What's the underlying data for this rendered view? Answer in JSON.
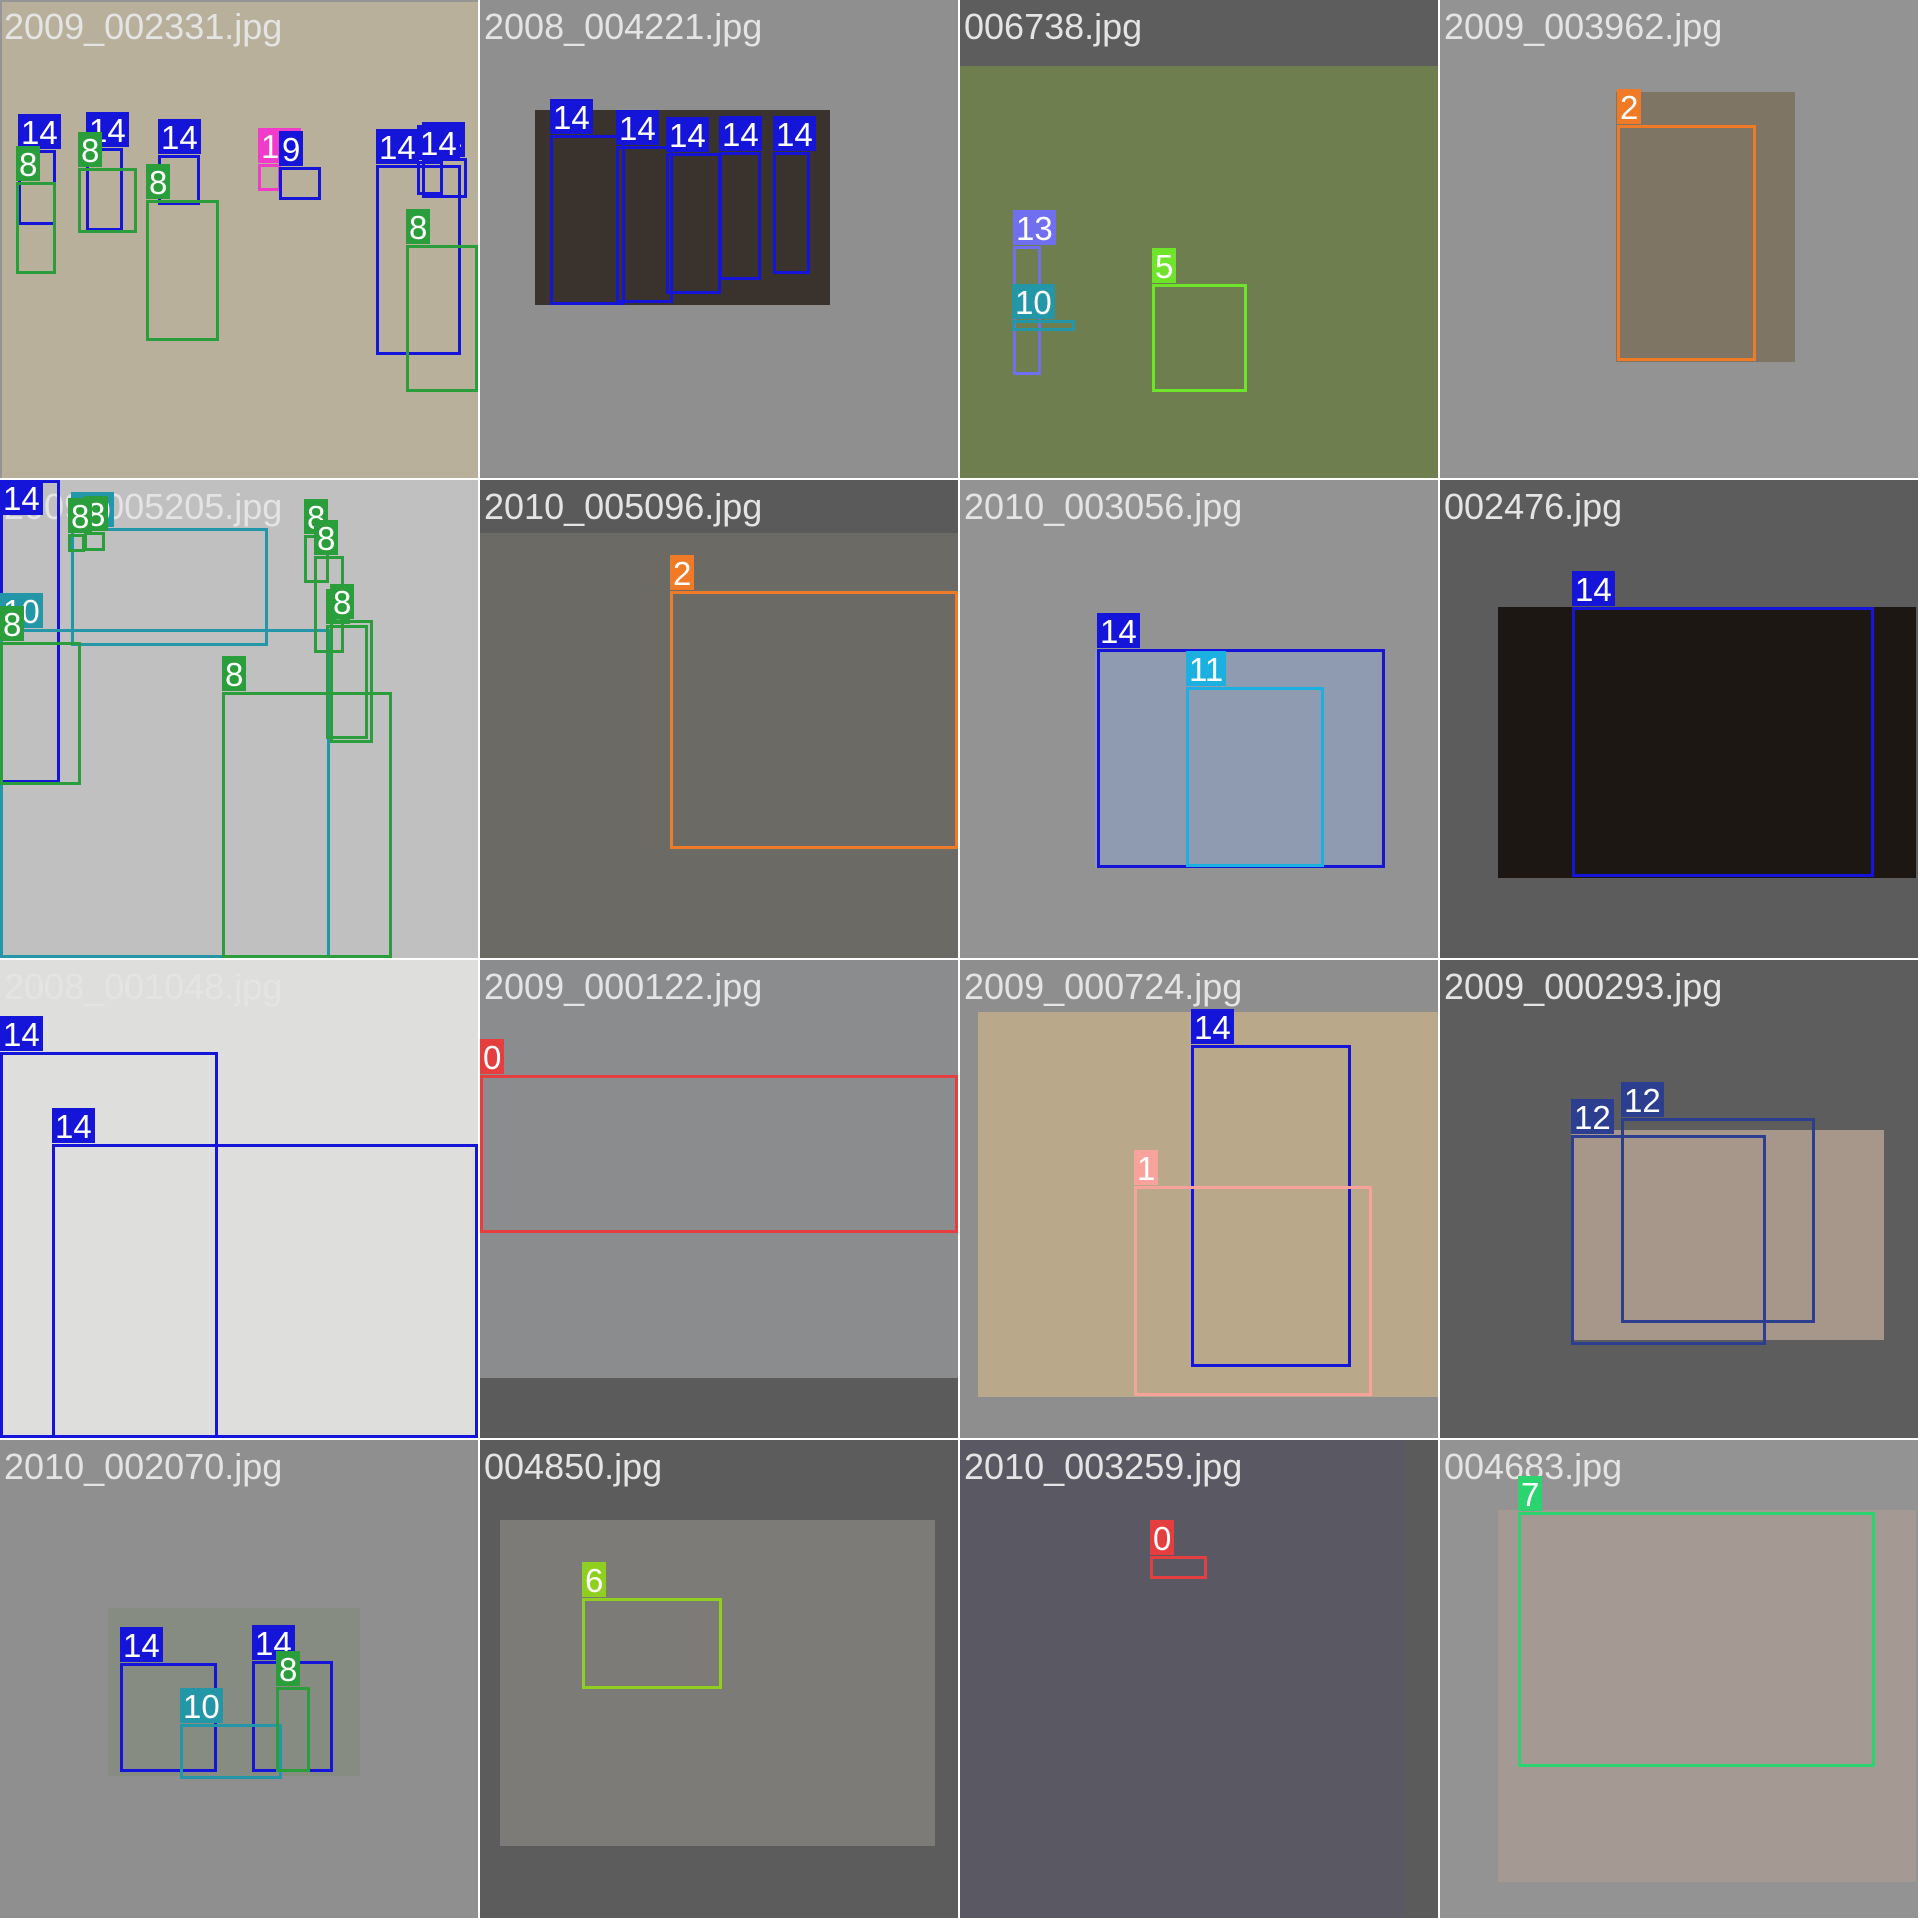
{
  "tiles": [
    {
      "file": "2009_002331.jpg",
      "bg": "#959595",
      "pic": "#b8b09a",
      "labels": [
        "14",
        "14",
        "14",
        "14",
        "14",
        "14",
        "19",
        "9",
        "8",
        "8",
        "8",
        "8"
      ]
    },
    {
      "file": "2008_004221.jpg",
      "bg": "#8f8f8f",
      "pic": "#3a332d",
      "labels": [
        "14",
        "14",
        "14",
        "14",
        "14"
      ]
    },
    {
      "file": "006738.jpg",
      "bg": "#5d5d5d",
      "pic": "#6f7e4e",
      "labels": [
        "13",
        "10",
        "5"
      ]
    },
    {
      "file": "2009_003962.jpg",
      "bg": "#939393",
      "pic": "#7f7565",
      "labels": [
        "2"
      ]
    },
    {
      "file": "2009_005205.jpg",
      "bg": "#8e8e8e",
      "pic": "#c0c0c0",
      "labels": [
        "14",
        "10",
        "10",
        "8",
        "8",
        "8",
        "8",
        "8",
        "8",
        "8",
        "8"
      ]
    },
    {
      "file": "2010_005096.jpg",
      "bg": "#5a5a5a",
      "pic": "#6b6a64",
      "labels": [
        "2"
      ]
    },
    {
      "file": "2010_003056.jpg",
      "bg": "#939393",
      "pic": "#8f9bb0",
      "labels": [
        "14",
        "11"
      ]
    },
    {
      "file": "002476.jpg",
      "bg": "#5c5c5c",
      "pic": "#1d1714",
      "labels": [
        "14"
      ]
    },
    {
      "file": "2008_001048.jpg",
      "bg": "#959595",
      "pic": "#dedfdc",
      "labels": [
        "14",
        "14"
      ]
    },
    {
      "file": "2009_000122.jpg",
      "bg": "#5b5b5b",
      "pic": "#8a8c8d",
      "labels": [
        "0"
      ]
    },
    {
      "file": "2009_000724.jpg",
      "bg": "#8e8e8e",
      "pic": "#b9a98a",
      "labels": [
        "14",
        "1"
      ]
    },
    {
      "file": "2009_000293.jpg",
      "bg": "#5d5d5d",
      "pic": "#a6978a",
      "labels": [
        "12",
        "12"
      ]
    },
    {
      "file": "2010_002070.jpg",
      "bg": "#8f8f8f",
      "pic": "#868c81",
      "labels": [
        "14",
        "14",
        "10",
        "8"
      ]
    },
    {
      "file": "004850.jpg",
      "bg": "#5c5c5c",
      "pic": "#7d7b78",
      "labels": [
        "6"
      ]
    },
    {
      "file": "2010_003259.jpg",
      "bg": "#5b5b5b",
      "pic": "#5a5863",
      "labels": [
        "0"
      ]
    },
    {
      "file": "004683.jpg",
      "bg": "#939393",
      "pic": "#a49a93",
      "labels": [
        "7"
      ]
    }
  ],
  "class_colors": {
    "0": "#e53e3e",
    "1": "#f7a29b",
    "2": "#f07a26",
    "5": "#6ee52a",
    "6": "#8fcf1f",
    "7": "#2bd46e",
    "8": "#2a9e3a",
    "10": "#2396a8",
    "11": "#1cb0e0",
    "12": "#2c3e8f",
    "13": "#6f6ff0",
    "14": "#1515d9",
    "19": "#f03cc8"
  }
}
